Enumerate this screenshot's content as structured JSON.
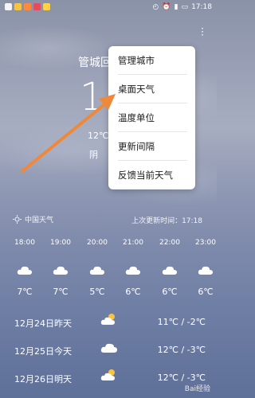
{
  "status": {
    "time": "17:18",
    "right_icons": [
      "notification-icon",
      "alarm-icon",
      "signal-icon",
      "battery-icon"
    ]
  },
  "header": {
    "city": "管城回",
    "temperature": "1",
    "range": "12℃",
    "condition": "阴 空"
  },
  "menu": {
    "items": [
      "管理城市",
      "桌面天气",
      "温度单位",
      "更新间隔",
      "反馈当前天气"
    ]
  },
  "provider": {
    "name": "中国天气",
    "updated_label": "上次更新时间：17:18"
  },
  "hourly": [
    {
      "time": "18:00",
      "temp": "7℃"
    },
    {
      "time": "19:00",
      "temp": "7℃"
    },
    {
      "time": "20:00",
      "temp": "5℃"
    },
    {
      "time": "21:00",
      "temp": "6℃"
    },
    {
      "time": "22:00",
      "temp": "6℃"
    },
    {
      "time": "23:00",
      "temp": "6℃"
    }
  ],
  "daily": [
    {
      "date": "12月24日昨天",
      "range": "11℃ / -2℃",
      "icon": "partly-cloudy-icon"
    },
    {
      "date": "12月25日今天",
      "range": "12℃ / -3℃",
      "icon": "cloudy-icon"
    },
    {
      "date": "12月26日明天",
      "range": "12℃ / -3℃",
      "icon": "partly-cloudy-icon"
    }
  ],
  "watermark": "Bai经验",
  "colors": {
    "arrow": "#f0883a",
    "menu_bg": "#ffffff"
  }
}
